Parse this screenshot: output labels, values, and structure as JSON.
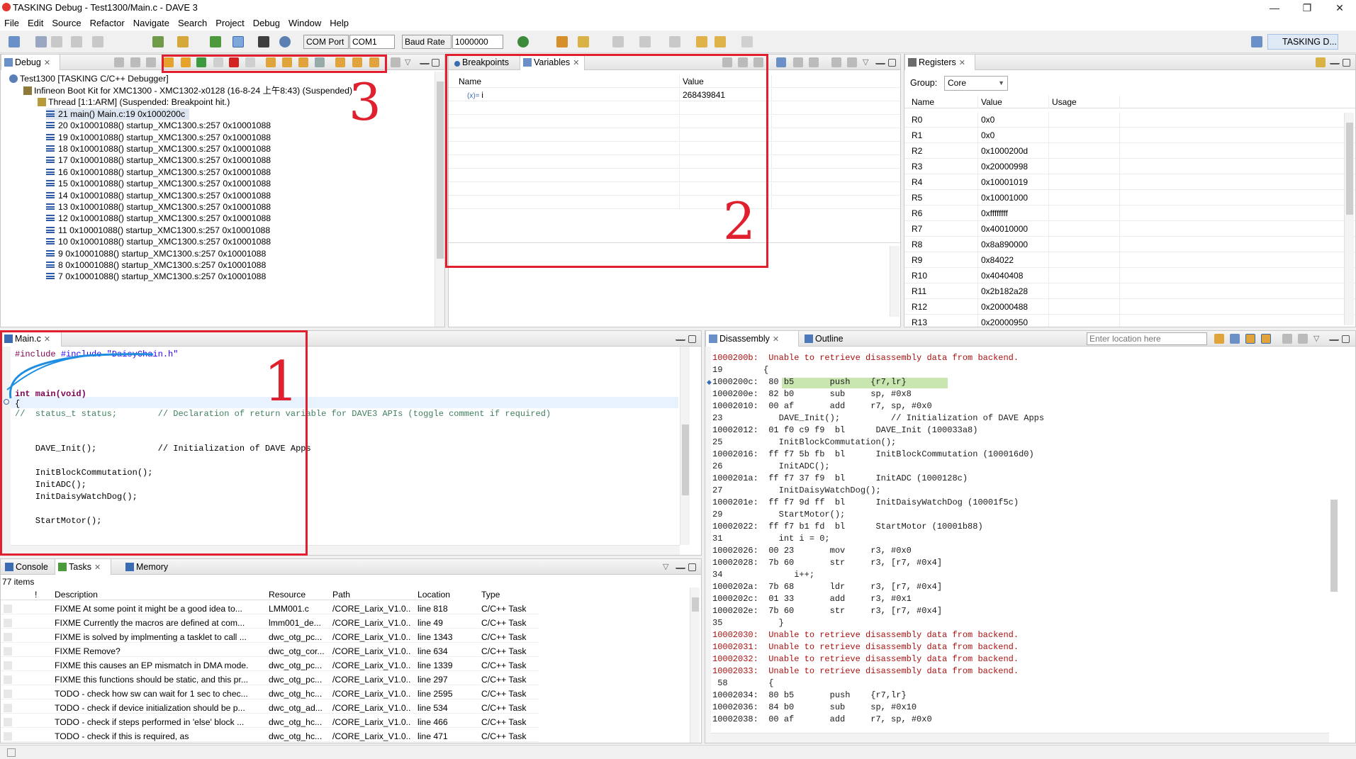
{
  "window": {
    "title": "TASKING Debug - Test1300/Main.c - DAVE 3",
    "controls": [
      "—",
      "❐",
      "✕"
    ]
  },
  "menu": [
    "File",
    "Edit",
    "Source",
    "Refactor",
    "Navigate",
    "Search",
    "Project",
    "Debug",
    "Window",
    "Help"
  ],
  "toolbar": {
    "com_port_label": "COM Port",
    "com_port_value": "COM1",
    "baud_rate_label": "Baud Rate",
    "baud_rate_value": "1000000",
    "perspective_label": "TASKING D..."
  },
  "debug_view": {
    "tab": "Debug",
    "project": "Test1300 [TASKING C/C++ Debugger]",
    "target": "Infineon Boot Kit for XMC1300 - XMC1302-x0128 (16-8-24 上午8:43) (Suspended)",
    "thread": "Thread [1:1:ARM] (Suspended: Breakpoint hit.)",
    "frames": [
      "21 main() Main.c:19 0x1000200c",
      "20 0x10001088() startup_XMC1300.s:257 0x10001088",
      "19 0x10001088() startup_XMC1300.s:257 0x10001088",
      "18 0x10001088() startup_XMC1300.s:257 0x10001088",
      "17 0x10001088() startup_XMC1300.s:257 0x10001088",
      "16 0x10001088() startup_XMC1300.s:257 0x10001088",
      "15 0x10001088() startup_XMC1300.s:257 0x10001088",
      "14 0x10001088() startup_XMC1300.s:257 0x10001088",
      "13 0x10001088() startup_XMC1300.s:257 0x10001088",
      "12 0x10001088() startup_XMC1300.s:257 0x10001088",
      "11 0x10001088() startup_XMC1300.s:257 0x10001088",
      "10 0x10001088() startup_XMC1300.s:257 0x10001088",
      "9 0x10001088() startup_XMC1300.s:257 0x10001088",
      "8 0x10001088() startup_XMC1300.s:257 0x10001088",
      "7 0x10001088() startup_XMC1300.s:257 0x10001088"
    ]
  },
  "variables_view": {
    "tabs": [
      "Breakpoints",
      "Variables"
    ],
    "columns": [
      "Name",
      "Value"
    ],
    "rows": [
      {
        "name": "i",
        "value": "268439841"
      }
    ]
  },
  "registers_view": {
    "tab": "Registers",
    "group_label": "Group:",
    "group_value": "Core",
    "columns": [
      "Name",
      "Value",
      "Usage"
    ],
    "rows": [
      {
        "name": "R0",
        "value": "0x0"
      },
      {
        "name": "R1",
        "value": "0x0"
      },
      {
        "name": "R2",
        "value": "0x1000200d"
      },
      {
        "name": "R3",
        "value": "0x20000998"
      },
      {
        "name": "R4",
        "value": "0x10001019"
      },
      {
        "name": "R5",
        "value": "0x10001000"
      },
      {
        "name": "R6",
        "value": "0xffffffff"
      },
      {
        "name": "R7",
        "value": "0x40010000"
      },
      {
        "name": "R8",
        "value": "0x8a890000"
      },
      {
        "name": "R9",
        "value": "0x84022"
      },
      {
        "name": "R10",
        "value": "0x4040408"
      },
      {
        "name": "R11",
        "value": "0x2b182a28"
      },
      {
        "name": "R12",
        "value": "0x20000488"
      },
      {
        "name": "R13",
        "value": "0x20000950"
      }
    ]
  },
  "editor": {
    "tab": "Main.c",
    "lines": [
      "#include \"DaisyChain.h\"",
      "",
      "",
      "int main(void)",
      "{",
      "//  status_t status;        // Declaration of return variable for DAVE3 APIs (toggle comment if required)",
      "",
      "",
      "    DAVE_Init();            // Initialization of DAVE Apps",
      "",
      "    InitBlockCommutation();",
      "    InitADC();",
      "    InitDaisyWatchDog();",
      "",
      "    StartMotor();"
    ]
  },
  "disassembly_view": {
    "tabs": [
      "Disassembly",
      "Outline"
    ],
    "location_placeholder": "Enter location here",
    "lines": [
      "1000200b:  Unable to retrieve disassembly data from backend.",
      "19        {",
      "1000200c:  80 b5       push    {r7,lr}",
      "1000200e:  82 b0       sub     sp, #0x8",
      "10002010:  00 af       add     r7, sp, #0x0",
      "23           DAVE_Init();          // Initialization of DAVE Apps",
      "10002012:  01 f0 c9 f9  bl      DAVE_Init (100033a8)",
      "25           InitBlockCommutation();",
      "10002016:  ff f7 5b fb  bl      InitBlockCommutation (100016d0)",
      "26           InitADC();",
      "1000201a:  ff f7 37 f9  bl      InitADC (1000128c)",
      "27           InitDaisyWatchDog();",
      "1000201e:  ff f7 9d ff  bl      InitDaisyWatchDog (10001f5c)",
      "29           StartMotor();",
      "10002022:  ff f7 b1 fd  bl      StartMotor (10001b88)",
      "31           int i = 0;",
      "10002026:  00 23       mov     r3, #0x0",
      "10002028:  7b 60       str     r3, [r7, #0x4]",
      "34              i++;",
      "1000202a:  7b 68       ldr     r3, [r7, #0x4]",
      "1000202c:  01 33       add     r3, #0x1",
      "1000202e:  7b 60       str     r3, [r7, #0x4]",
      "35           }",
      "10002030:  Unable to retrieve disassembly data from backend.",
      "10002031:  Unable to retrieve disassembly data from backend.",
      "10002032:  Unable to retrieve disassembly data from backend.",
      "10002033:  Unable to retrieve disassembly data from backend.",
      " 58        {",
      "10002034:  80 b5       push    {r7,lr}",
      "10002036:  84 b0       sub     sp, #0x10",
      "10002038:  00 af       add     r7, sp, #0x0"
    ]
  },
  "tasks_view": {
    "tabs": [
      "Console",
      "Tasks",
      "Memory"
    ],
    "count": "77 items",
    "columns": [
      "!",
      "Description",
      "Resource",
      "Path",
      "Location",
      "Type"
    ],
    "rows": [
      [
        "FIXME At some point it might be a good idea to...",
        "LMM001.c",
        "/CORE_Larix_V1.0...",
        "line 818",
        "C/C++ Task"
      ],
      [
        "FIXME Currently the macros are defined at com...",
        "lmm001_de...",
        "/CORE_Larix_V1.0...",
        "line 49",
        "C/C++ Task"
      ],
      [
        "FIXME is solved by implmenting a tasklet to call ...",
        "dwc_otg_pc...",
        "/CORE_Larix_V1.0...",
        "line 1343",
        "C/C++ Task"
      ],
      [
        "FIXME Remove?",
        "dwc_otg_cor...",
        "/CORE_Larix_V1.0...",
        "line 634",
        "C/C++ Task"
      ],
      [
        "FIXME this causes an EP mismatch in DMA mode.",
        "dwc_otg_pc...",
        "/CORE_Larix_V1.0...",
        "line 1339",
        "C/C++ Task"
      ],
      [
        "FIXME this functions should be static, and this pr...",
        "dwc_otg_pc...",
        "/CORE_Larix_V1.0...",
        "line 297",
        "C/C++ Task"
      ],
      [
        "TODO - check how sw can wait for 1 sec to chec...",
        "dwc_otg_hc...",
        "/CORE_Larix_V1.0...",
        "line 2595",
        "C/C++ Task"
      ],
      [
        "TODO - check if device initialization should be p...",
        "dwc_otg_ad...",
        "/CORE_Larix_V1.0...",
        "line 534",
        "C/C++ Task"
      ],
      [
        "TODO - check if steps performed in 'else' block ...",
        "dwc_otg_hc...",
        "/CORE_Larix_V1.0...",
        "line 466",
        "C/C++ Task"
      ],
      [
        "TODO - check if this is required, as",
        "dwc_otg_hc...",
        "/CORE_Larix_V1.0...",
        "line 471",
        "C/C++ Task"
      ]
    ]
  },
  "annotations": {
    "one": "1",
    "two": "2",
    "three": "3"
  },
  "colors": {
    "accent_red": "#e0202e",
    "current_line": "#c9e5b0",
    "comment": "#3f7f5f",
    "keyword": "#7f0055"
  }
}
